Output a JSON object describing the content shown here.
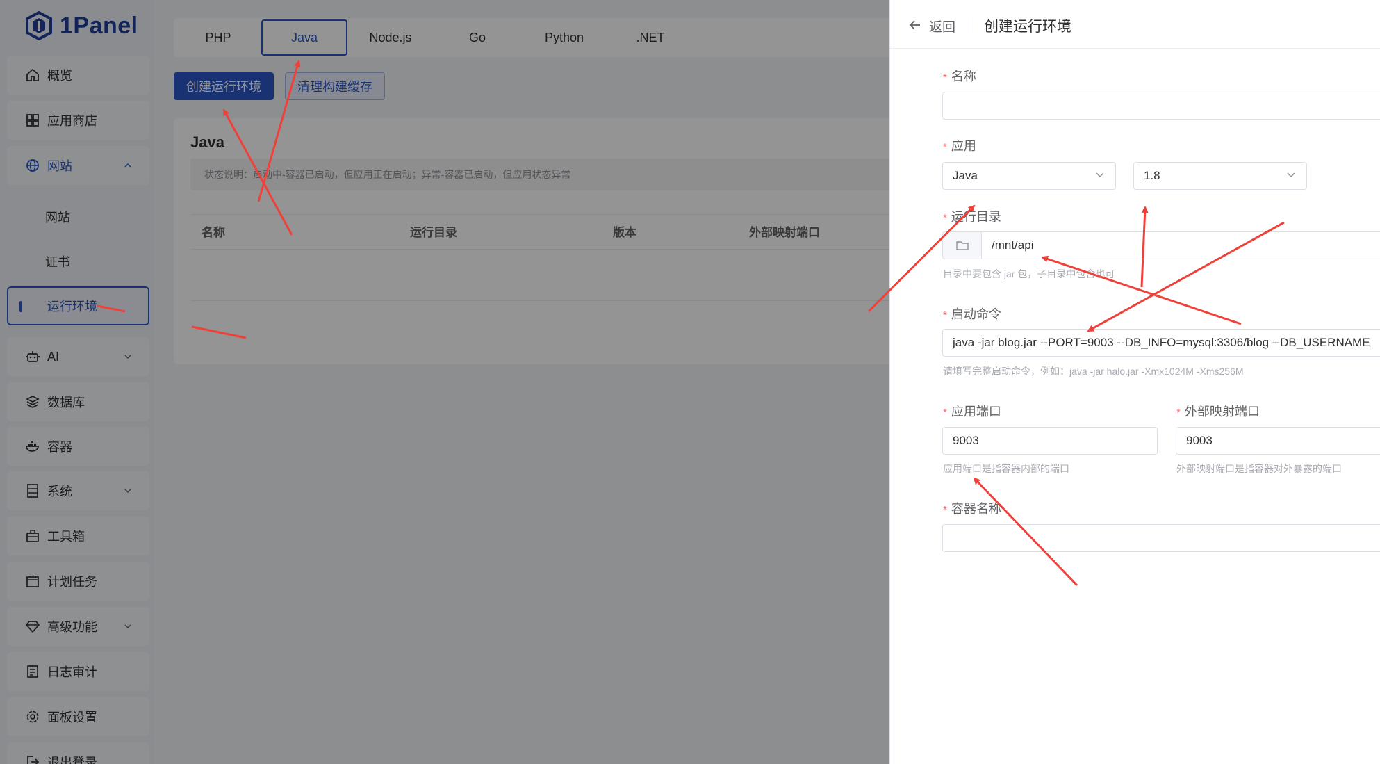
{
  "brand": {
    "name": "1Panel"
  },
  "sidebar": {
    "items": [
      {
        "label": "概览",
        "icon": "home-icon"
      },
      {
        "label": "应用商店",
        "icon": "grid-icon"
      },
      {
        "label": "网站",
        "icon": "globe-icon",
        "expanded": true
      },
      {
        "label": "网站"
      },
      {
        "label": "证书"
      },
      {
        "label": "运行环境",
        "active": true
      },
      {
        "label": "AI",
        "icon": "robot-icon"
      },
      {
        "label": "数据库",
        "icon": "database-icon"
      },
      {
        "label": "容器",
        "icon": "docker-icon"
      },
      {
        "label": "系统",
        "icon": "server-icon"
      },
      {
        "label": "工具箱",
        "icon": "toolbox-icon"
      },
      {
        "label": "计划任务",
        "icon": "calendar-icon"
      },
      {
        "label": "高级功能",
        "icon": "diamond-icon"
      },
      {
        "label": "日志审计",
        "icon": "log-icon"
      },
      {
        "label": "面板设置",
        "icon": "gear-icon"
      },
      {
        "label": "退出登录",
        "icon": "logout-icon"
      }
    ]
  },
  "main": {
    "tabs": [
      "PHP",
      "Java",
      "Node.js",
      "Go",
      "Python",
      ".NET"
    ],
    "active_tab": "Java",
    "create_button": "创建运行环境",
    "clear_cache_button": "清理构建缓存",
    "card_title": "Java",
    "status_note": "状态说明：启动中-容器已启动，但应用正在启动；异常-容器已启动，但应用状态异常",
    "columns": [
      "名称",
      "运行目录",
      "版本",
      "外部映射端口"
    ]
  },
  "drawer": {
    "back_label": "返回",
    "title": "创建运行环境",
    "name_label": "名称",
    "name_value": "",
    "app_label": "应用",
    "app_value": "Java",
    "version_value": "1.8",
    "dir_label": "运行目录",
    "dir_value": "/mnt/api",
    "dir_hint": "目录中要包含 jar 包，子目录中包含也可",
    "cmd_label": "启动命令",
    "cmd_value": "java -jar blog.jar --PORT=9003 --DB_INFO=mysql:3306/blog --DB_USERNAME",
    "cmd_hint": "请填写完整启动命令，例如：java -jar halo.jar -Xmx1024M -Xms256M",
    "app_port_label": "应用端口",
    "app_port_value": "9003",
    "app_port_hint": "应用端口是指容器内部的端口",
    "ext_port_label": "外部映射端口",
    "ext_port_value": "9003",
    "ext_port_hint": "外部映射端口是指容器对外暴露的端口",
    "container_label": "容器名称",
    "container_value": ""
  },
  "colors": {
    "primary": "#2a57c6",
    "required": "#f56c6c",
    "annotation": "#f0403a"
  }
}
